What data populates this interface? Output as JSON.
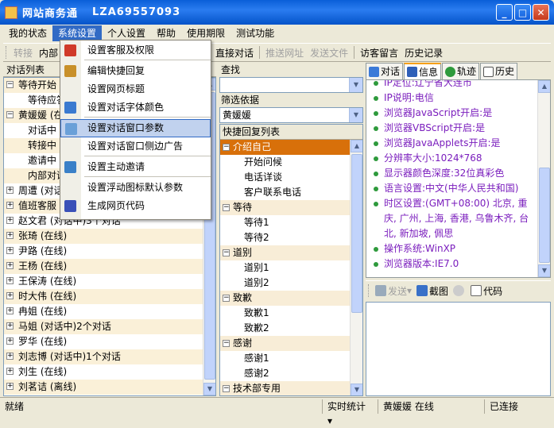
{
  "window": {
    "title": "网站商务通",
    "account_id": "LZA69557093",
    "buttons": {
      "minimize": "_",
      "maximize": "□",
      "close": "✕"
    }
  },
  "menubar": [
    "我的状态",
    "系统设置",
    "个人设置",
    "帮助",
    "使用期限",
    "测试功能"
  ],
  "toolbar": {
    "transfer": "转接",
    "internal": "内部",
    "invite": "邀请",
    "direct_chat": "直接对话",
    "push_url": "推送网址",
    "send_file": "发送文件",
    "visitor_message": "访客留言",
    "history": "历史记录"
  },
  "left": {
    "header": "对话列表",
    "rows": [
      {
        "text": "等待开始",
        "type": "group",
        "sign": "−"
      },
      {
        "text": "等待应答",
        "type": "child"
      },
      {
        "text": "黄媛媛 (在",
        "type": "group",
        "sign": "−"
      },
      {
        "text": "对话中",
        "type": "child"
      },
      {
        "text": "转接中",
        "type": "child"
      },
      {
        "text": "邀请中",
        "type": "child"
      },
      {
        "text": "内部对话",
        "type": "child"
      },
      {
        "text": "周遭 (对话",
        "type": "group",
        "sign": "+"
      },
      {
        "text": "值班客服",
        "type": "group",
        "sign": "+"
      },
      {
        "text": "赵文君 (对话中)3个对话",
        "type": "group",
        "sign": "+"
      },
      {
        "text": "张琦 (在线)",
        "type": "group",
        "sign": "+"
      },
      {
        "text": "尹路 (在线)",
        "type": "group",
        "sign": "+"
      },
      {
        "text": "王杨 (在线)",
        "type": "group",
        "sign": "+"
      },
      {
        "text": "王保涛 (在线)",
        "type": "group",
        "sign": "+"
      },
      {
        "text": "时大伟 (在线)",
        "type": "group",
        "sign": "+"
      },
      {
        "text": "冉姐 (在线)",
        "type": "group",
        "sign": "+"
      },
      {
        "text": "马姐 (对话中)2个对话",
        "type": "group",
        "sign": "+"
      },
      {
        "text": "罗华 (在线)",
        "type": "group",
        "sign": "+"
      },
      {
        "text": "刘志博 (对话中)1个对话",
        "type": "group",
        "sign": "+"
      },
      {
        "text": "刘生 (在线)",
        "type": "group",
        "sign": "+"
      },
      {
        "text": "刘茗诘 (离线)",
        "type": "group",
        "sign": "+"
      }
    ]
  },
  "middle": {
    "search_label": "查找",
    "search_value": "",
    "filter_label": "筛选依据",
    "filter_value": "黄媛媛",
    "list_header": "快捷回复列表",
    "groups": [
      {
        "name": "介绍自己",
        "selected": true,
        "items": [
          "开始问候",
          "电话详谈",
          "客户联系电话"
        ]
      },
      {
        "name": "等待",
        "items": [
          "等待1",
          "等待2"
        ]
      },
      {
        "name": "道别",
        "items": [
          "道别1",
          "道别2"
        ]
      },
      {
        "name": "致歉",
        "items": [
          "致歉1",
          "致歉2"
        ]
      },
      {
        "name": "感谢",
        "items": [
          "感谢1",
          "感谢2"
        ]
      },
      {
        "name": "技术部专用",
        "items": []
      }
    ]
  },
  "right": {
    "tabs": [
      "对话",
      "信息",
      "轨迹",
      "历史"
    ],
    "info_lines": [
      "IP定位:辽宁省大连市",
      "IP说明:电信",
      "浏览器JavaScript开启:是",
      "浏览器VBScript开启:是",
      "浏览器JavaApplets开启:是",
      "分辨率大小:1024*768",
      "显示器颜色深度:32位真彩色",
      "语言设置:中文(中华人民共和国)",
      "时区设置:(GMT+08:00) 北京, 重庆, 广州, 上海, 香港, 乌鲁木齐, 台北, 新加坡, 佩思",
      "操作系统:WinXP",
      "浏览器版本:IE7.0"
    ],
    "toolbar": {
      "send": "发送",
      "screenshot": "截图",
      "code": "代码"
    }
  },
  "statusbar": {
    "ready": "就绪",
    "realtime": "实时统计",
    "user_status": "黄媛媛 在线",
    "connection": "已连接"
  },
  "dropdown": {
    "items": [
      {
        "label": "设置客服及权限",
        "icon": "user-permission-icon"
      },
      {
        "sep": true
      },
      {
        "label": "编辑快捷回复",
        "icon": "edit-reply-icon"
      },
      {
        "label": "设置网页标题",
        "icon": "none"
      },
      {
        "label": "设置对话字体颜色",
        "icon": "font-color-icon"
      },
      {
        "sep": true
      },
      {
        "label": "设置对话窗口参数",
        "icon": "window-params-icon",
        "highlighted": true
      },
      {
        "label": "设置对话窗口侧边广告",
        "icon": "none"
      },
      {
        "sep": true
      },
      {
        "label": "设置主动邀请",
        "icon": "invite-icon"
      },
      {
        "sep": true
      },
      {
        "label": "设置浮动图标默认参数",
        "icon": "none"
      },
      {
        "label": "生成网页代码",
        "icon": "code-gen-icon"
      }
    ]
  },
  "colors": {
    "selected_group": "#d8700a",
    "highlight": "#316ac5",
    "info_text": "#7a1dbd",
    "bullet": "#2e9a3c"
  }
}
